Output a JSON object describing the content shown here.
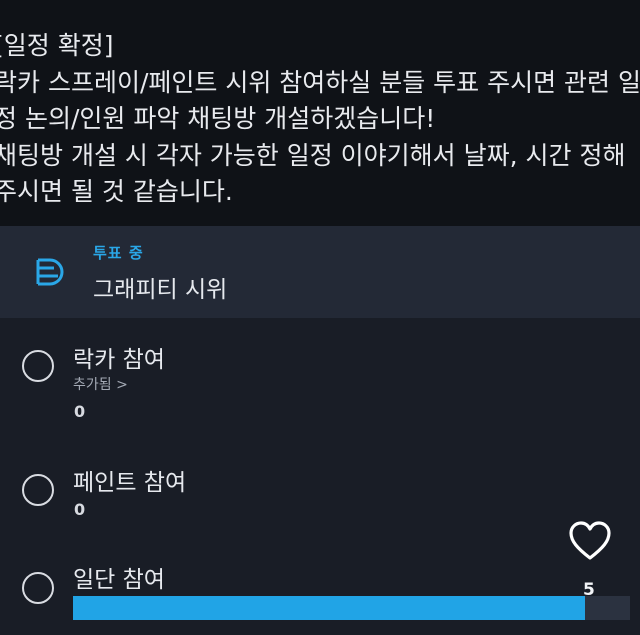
{
  "notice": {
    "lines": [
      "[일정 확정]",
      "락카 스프레이/페인트 시위 참여하실 분들 투표 주시면 관련 일",
      "정 논의/인원 파악 채팅방 개설하겠습니다!",
      "채팅방 개설 시 각자 가능한 일정 이야기해서 날짜, 시간 정해",
      "주시면 될 것 같습니다."
    ]
  },
  "poll": {
    "icon": "poll-icon",
    "status": "투표 중",
    "title": "그래피티 시위",
    "accent_color": "#21a4e6",
    "options": [
      {
        "label": "락카 참여",
        "sub": "추가됨 >",
        "count": "0"
      },
      {
        "label": "페인트 참여",
        "count": "0"
      },
      {
        "label": "일단 참여",
        "vote_fraction": 0.92
      }
    ]
  },
  "reactions": {
    "icon": "heart-icon",
    "like_count": "5"
  }
}
